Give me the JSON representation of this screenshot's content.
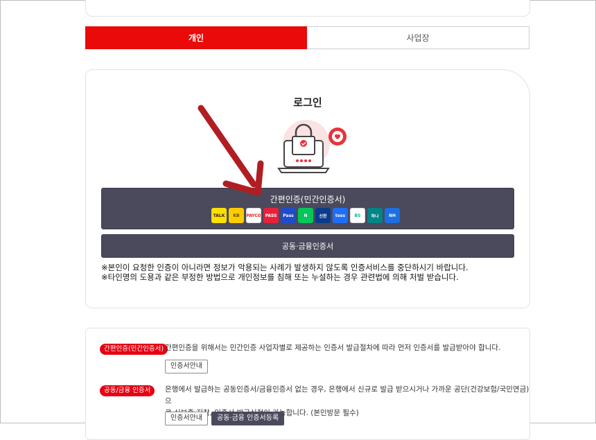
{
  "tabs": [
    {
      "label": "개인",
      "active": true
    },
    {
      "label": "사업장",
      "active": false
    }
  ],
  "login": {
    "title": "로그인",
    "simple_auth_label": "간편인증(민간인증서)",
    "joint_auth_label": "공동·금융인증서",
    "notices": [
      "※본인이 요청한 인증이 아니라면 정보가 악용되는 사례가 발생하지 않도록 인증서비스를 중단하시기 바랍니다.",
      "※타인명의 도용과 같은 부정한 방법으로 개인정보를 침해 또는 누설하는 경우 관련법에 의해 처벌 받습니다."
    ]
  },
  "providers": [
    {
      "name": "kakao-talk",
      "text": "TALK",
      "bg": "#fae100",
      "fg": "#3a1d1d"
    },
    {
      "name": "kb-star",
      "text": "KB",
      "bg": "#ffcc00",
      "fg": "#5a4a00"
    },
    {
      "name": "payco",
      "text": "PAYCO",
      "bg": "#ffffff",
      "fg": "#e1251b"
    },
    {
      "name": "pass",
      "text": "PASS",
      "bg": "#e8203a",
      "fg": "#ffffff"
    },
    {
      "name": "samsung-pass",
      "text": "Pass",
      "bg": "#1f4cc9",
      "fg": "#ffffff"
    },
    {
      "name": "naver",
      "text": "N",
      "bg": "#03c75a",
      "fg": "#ffffff"
    },
    {
      "name": "shinhan",
      "text": "신한",
      "bg": "#0a3b8c",
      "fg": "#ffffff"
    },
    {
      "name": "toss",
      "text": "toss",
      "bg": "#1e6ef7",
      "fg": "#ffffff"
    },
    {
      "name": "bank-sign",
      "text": "BS",
      "bg": "#ffffff",
      "fg": "#00b38a"
    },
    {
      "name": "hana",
      "text": "하나",
      "bg": "#008485",
      "fg": "#ffffff"
    },
    {
      "name": "nh",
      "text": "NH",
      "bg": "#1d6fe0",
      "fg": "#ffffff"
    }
  ],
  "guides": [
    {
      "badge": "간편인증(민간인증서)",
      "text_lines": [
        "간편인증을 위해서는 민간인증 사업자별로 제공하는 인증서 발급절차에 따라 먼저 인증서를 발급받아야 합니다."
      ],
      "buttons": [
        "인증서안내"
      ]
    },
    {
      "badge": "공동/금융 인증서",
      "text_lines": [
        "은행에서 발급하는 공동인증서/금융인증서 없는 경우, 은행에서 신규로 발급 받으시거나 가까운 공단(건강보험/국민연금)으",
        "로 신분증 지참, 인증서 발급신청이 가능합니다. (본인방문 필수)"
      ],
      "buttons": [
        "인증서안내",
        "공동·금융 인증서등록"
      ]
    }
  ],
  "colors": {
    "accent_red": "#ea0a0a",
    "dark_button": "#4a4a5c",
    "arrow": "#b01e23"
  }
}
